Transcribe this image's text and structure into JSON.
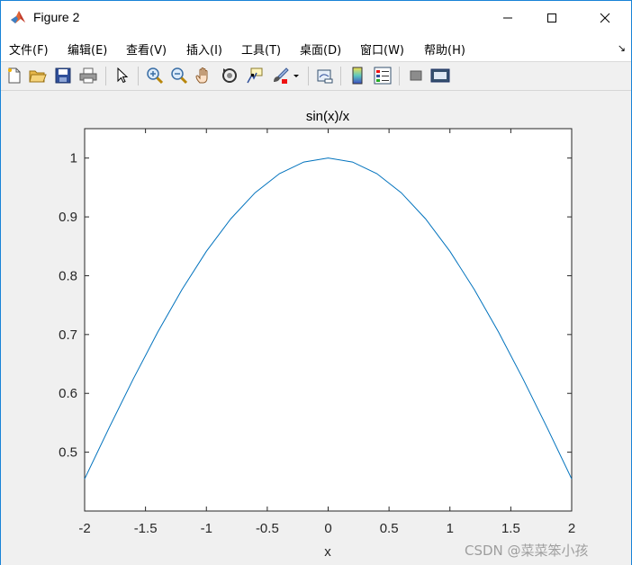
{
  "window": {
    "title": "Figure 2"
  },
  "menu": {
    "items": [
      {
        "label": "文件(F)"
      },
      {
        "label": "编辑(E)"
      },
      {
        "label": "查看(V)"
      },
      {
        "label": "插入(I)"
      },
      {
        "label": "工具(T)"
      },
      {
        "label": "桌面(D)"
      },
      {
        "label": "窗口(W)"
      },
      {
        "label": "帮助(H)"
      }
    ],
    "overflow_arrow": "↘"
  },
  "toolbar": {
    "icons": [
      "new-figure-icon",
      "open-file-icon",
      "save-icon",
      "print-icon",
      "pointer-icon",
      "zoom-in-icon",
      "zoom-out-icon",
      "pan-hand-icon",
      "rotate-3d-icon",
      "data-cursor-icon",
      "brush-icon",
      "dropdown-arrow-icon",
      "link-plot-icon",
      "colorbar-icon",
      "legend-icon",
      "hide-plot-tools-icon",
      "show-plot-tools-icon"
    ]
  },
  "chart_data": {
    "type": "line",
    "title": "sin(x)/x",
    "xlabel": "x",
    "ylabel": "",
    "xlim": [
      -2,
      2
    ],
    "ylim": [
      0.4,
      1.05
    ],
    "xticks": [
      -2,
      -1.5,
      -1,
      -0.5,
      0,
      0.5,
      1,
      1.5,
      2
    ],
    "xtick_labels": [
      "-2",
      "-1.5",
      "-1",
      "-0.5",
      "0",
      "0.5",
      "1",
      "1.5",
      "2"
    ],
    "yticks": [
      0.5,
      0.6,
      0.7,
      0.8,
      0.9,
      1
    ],
    "ytick_labels": [
      "0.5",
      "0.6",
      "0.7",
      "0.8",
      "0.9",
      "1"
    ],
    "grid": false,
    "line_color": "#0072bd",
    "series": [
      {
        "x": [
          -2,
          -1.8,
          -1.6,
          -1.4,
          -1.2,
          -1,
          -0.8,
          -0.6,
          -0.4,
          -0.2,
          0,
          0.2,
          0.4,
          0.6,
          0.8,
          1,
          1.2,
          1.4,
          1.6,
          1.8,
          2
        ],
        "values": [
          0.4546,
          0.541,
          0.6247,
          0.7039,
          0.7767,
          0.8415,
          0.8967,
          0.9411,
          0.9735,
          0.9933,
          1,
          0.9933,
          0.9735,
          0.9411,
          0.8967,
          0.8415,
          0.7767,
          0.7039,
          0.6247,
          0.541,
          0.4546
        ]
      }
    ]
  },
  "watermark": {
    "text": "CSDN @菜菜笨小孩"
  }
}
